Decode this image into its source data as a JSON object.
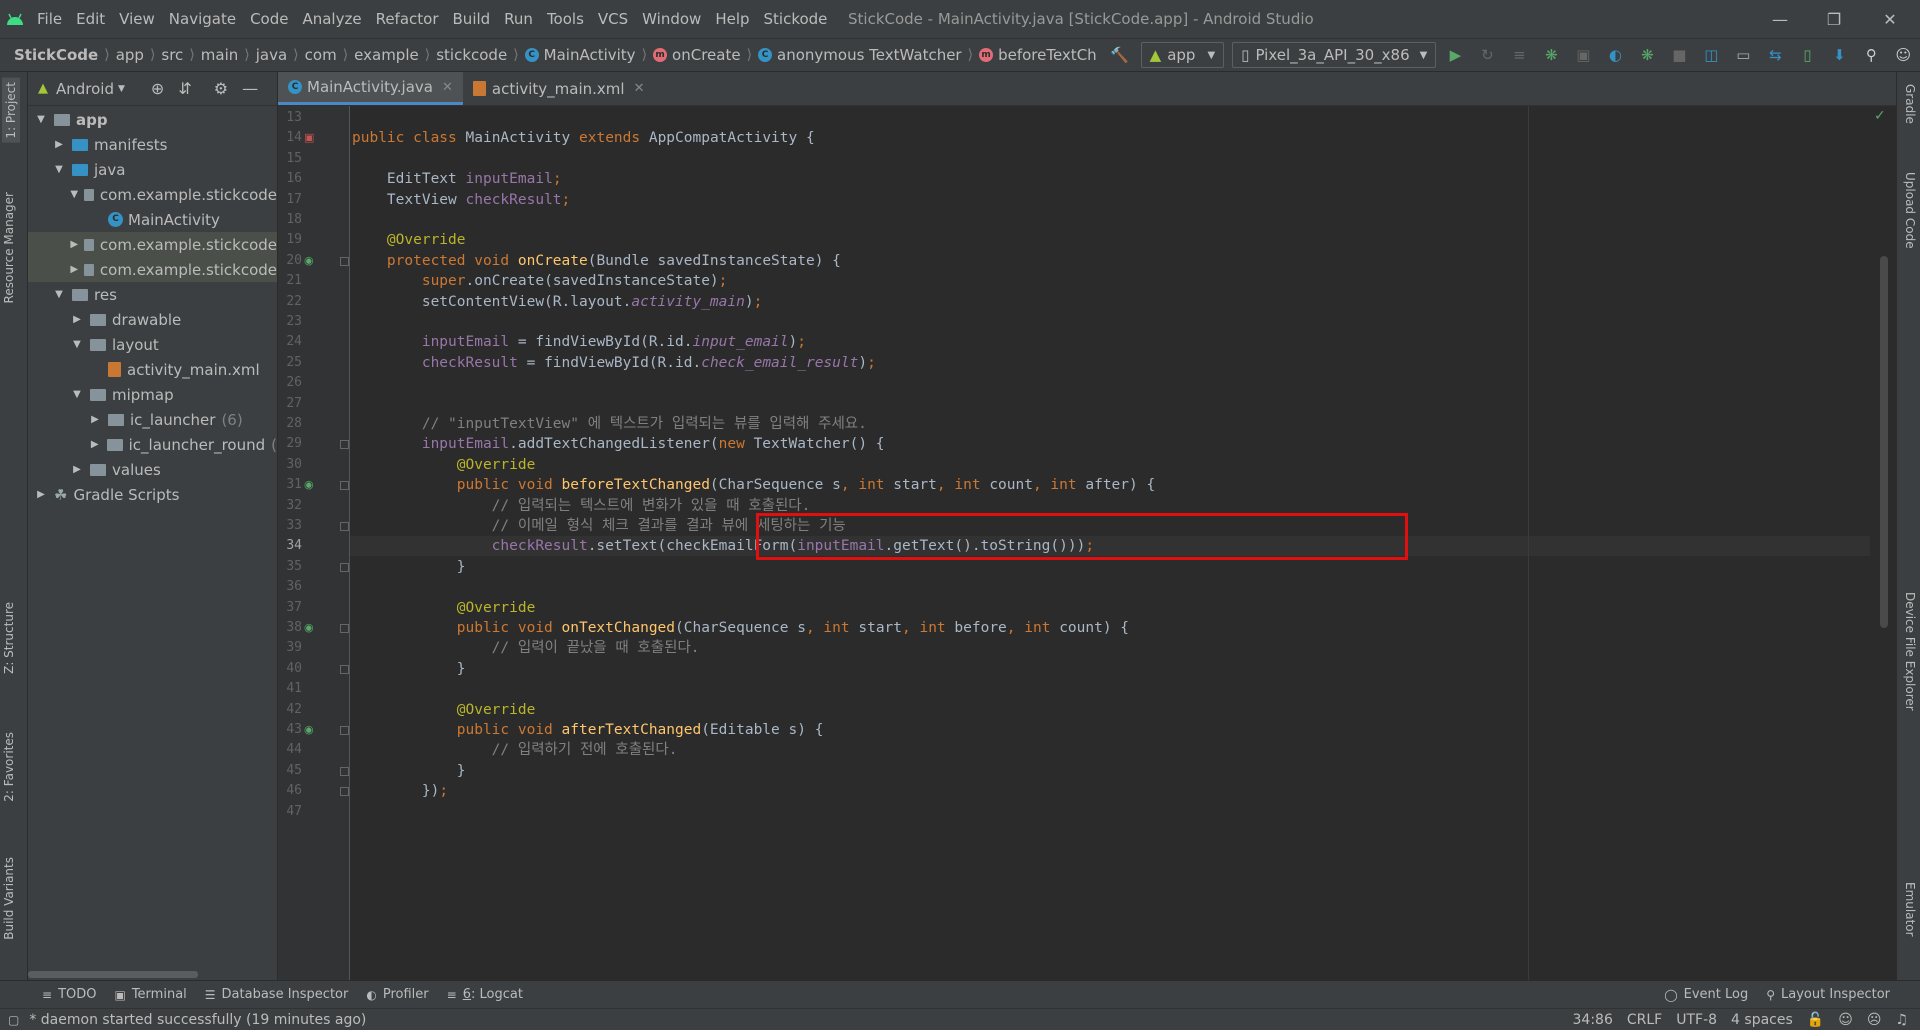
{
  "app_title": "StickCode - MainActivity.java [StickCode.app] - Android Studio",
  "menu": [
    "File",
    "Edit",
    "View",
    "Navigate",
    "Code",
    "Analyze",
    "Refactor",
    "Build",
    "Run",
    "Tools",
    "VCS",
    "Window",
    "Help",
    "Stickode"
  ],
  "breadcrumbs": [
    "StickCode",
    "app",
    "src",
    "main",
    "java",
    "com",
    "example",
    "stickcode",
    "MainActivity",
    "onCreate",
    "anonymous TextWatcher",
    "beforeTextCh"
  ],
  "run_config": "app",
  "device": "Pixel_3a_API_30_x86",
  "left_tool_tabs": [
    "1: Project",
    "Resource Manager",
    "Z: Structure",
    "2: Favorites",
    "Build Variants"
  ],
  "right_tool_tabs": [
    "Gradle",
    "Upload Code",
    "Device File Explorer",
    "Emulator"
  ],
  "project_panel": {
    "view_mode": "Android",
    "tree": [
      {
        "label": "app",
        "depth": 0,
        "arrow": "down",
        "icon": "folder",
        "bold": true
      },
      {
        "label": "manifests",
        "depth": 1,
        "arrow": "right",
        "icon": "folder-blue"
      },
      {
        "label": "java",
        "depth": 1,
        "arrow": "down",
        "icon": "folder-blue"
      },
      {
        "label": "com.example.stickcode",
        "depth": 2,
        "arrow": "down",
        "icon": "package"
      },
      {
        "label": "MainActivity",
        "depth": 3,
        "arrow": "",
        "icon": "class"
      },
      {
        "label": "com.example.stickcode",
        "depth": 2,
        "arrow": "right",
        "icon": "package",
        "selected": true
      },
      {
        "label": "com.example.stickcode",
        "depth": 2,
        "arrow": "right",
        "icon": "package",
        "selected": true
      },
      {
        "label": "res",
        "depth": 1,
        "arrow": "down",
        "icon": "folder"
      },
      {
        "label": "drawable",
        "depth": 2,
        "arrow": "right",
        "icon": "folder"
      },
      {
        "label": "layout",
        "depth": 2,
        "arrow": "down",
        "icon": "folder"
      },
      {
        "label": "activity_main.xml",
        "depth": 3,
        "arrow": "",
        "icon": "xml"
      },
      {
        "label": "mipmap",
        "depth": 2,
        "arrow": "down",
        "icon": "folder"
      },
      {
        "label": "ic_launcher",
        "depth": 3,
        "arrow": "right",
        "icon": "folder",
        "count": "(6)"
      },
      {
        "label": "ic_launcher_round",
        "depth": 3,
        "arrow": "right",
        "icon": "folder",
        "count": "("
      },
      {
        "label": "values",
        "depth": 2,
        "arrow": "right",
        "icon": "folder"
      },
      {
        "label": "Gradle Scripts",
        "depth": 0,
        "arrow": "right",
        "icon": "gradle"
      }
    ]
  },
  "editor_tabs": [
    {
      "label": "MainActivity.java",
      "active": true
    },
    {
      "label": "activity_main.xml",
      "active": false
    }
  ],
  "code_lines": [
    {
      "n": "13",
      "t": []
    },
    {
      "n": "14",
      "t": [
        [
          "kw",
          "public class "
        ],
        [
          "",
          "MainActivity "
        ],
        [
          "kw",
          "extends "
        ],
        [
          "",
          "AppCompatActivity {"
        ]
      ]
    },
    {
      "n": "15",
      "t": []
    },
    {
      "n": "16",
      "t": [
        [
          "",
          "    EditText "
        ],
        [
          "fld",
          "inputEmail"
        ],
        [
          "kw",
          ";"
        ]
      ]
    },
    {
      "n": "17",
      "t": [
        [
          "",
          "    TextView "
        ],
        [
          "fld",
          "checkResult"
        ],
        [
          "kw",
          ";"
        ]
      ]
    },
    {
      "n": "18",
      "t": []
    },
    {
      "n": "19",
      "t": [
        [
          "ann",
          "    @Override"
        ]
      ]
    },
    {
      "n": "20",
      "t": [
        [
          "kw",
          "    protected void "
        ],
        [
          "fn",
          "onCreate"
        ],
        [
          "",
          "(Bundle savedInstanceState) {"
        ]
      ]
    },
    {
      "n": "21",
      "t": [
        [
          "kw",
          "        super"
        ],
        [
          "",
          ".onCreate(savedInstanceState)"
        ],
        [
          "kw",
          ";"
        ]
      ]
    },
    {
      "n": "22",
      "t": [
        [
          "",
          "        setContentView(R.layout."
        ],
        [
          "it",
          "activity_main"
        ],
        [
          "",
          ")"
        ],
        [
          "kw",
          ";"
        ]
      ]
    },
    {
      "n": "23",
      "t": []
    },
    {
      "n": "24",
      "t": [
        [
          "fld",
          "        inputEmail "
        ],
        [
          "",
          "= findViewById(R.id."
        ],
        [
          "it",
          "input_email"
        ],
        [
          "",
          ")"
        ],
        [
          "kw",
          ";"
        ]
      ]
    },
    {
      "n": "25",
      "t": [
        [
          "fld",
          "        checkResult "
        ],
        [
          "",
          "= findViewById(R.id."
        ],
        [
          "it",
          "check_email_result"
        ],
        [
          "",
          ")"
        ],
        [
          "kw",
          ";"
        ]
      ]
    },
    {
      "n": "26",
      "t": []
    },
    {
      "n": "27",
      "t": []
    },
    {
      "n": "28",
      "t": [
        [
          "cm",
          "        // \"inputTextView\" 에 텍스트가 입력되는 뷰를 입력해 주세요."
        ]
      ]
    },
    {
      "n": "29",
      "t": [
        [
          "fld",
          "        inputEmail"
        ],
        [
          "",
          ".addTextChangedListener("
        ],
        [
          "kw",
          "new "
        ],
        [
          "",
          "TextWatcher() {"
        ]
      ]
    },
    {
      "n": "30",
      "t": [
        [
          "ann",
          "            @Override"
        ]
      ]
    },
    {
      "n": "31",
      "t": [
        [
          "kw",
          "            public void "
        ],
        [
          "fn",
          "beforeTextChanged"
        ],
        [
          "",
          "(CharSequence s"
        ],
        [
          "kw",
          ", int "
        ],
        [
          "",
          "start"
        ],
        [
          "kw",
          ", int "
        ],
        [
          "",
          "count"
        ],
        [
          "kw",
          ", int "
        ],
        [
          "",
          "after) {"
        ]
      ]
    },
    {
      "n": "32",
      "t": [
        [
          "cm",
          "                // 입력되는 텍스트에 변화가 있을 때 호출된다."
        ]
      ]
    },
    {
      "n": "33",
      "t": [
        [
          "cm",
          "                // 이메일 형식 체크 결과를 결과 뷰에 세팅하는 기능"
        ]
      ]
    },
    {
      "n": "34",
      "t": [
        [
          "fld",
          "                checkResult"
        ],
        [
          "",
          ".setText(checkEmailForm("
        ],
        [
          "fld",
          "inputEmail"
        ],
        [
          "",
          ".getText().toString()))"
        ],
        [
          "kw",
          ";"
        ]
      ]
    },
    {
      "n": "35",
      "t": [
        [
          "",
          "            }"
        ]
      ]
    },
    {
      "n": "36",
      "t": []
    },
    {
      "n": "37",
      "t": [
        [
          "ann",
          "            @Override"
        ]
      ]
    },
    {
      "n": "38",
      "t": [
        [
          "kw",
          "            public void "
        ],
        [
          "fn",
          "onTextChanged"
        ],
        [
          "",
          "(CharSequence s"
        ],
        [
          "kw",
          ", int "
        ],
        [
          "",
          "start"
        ],
        [
          "kw",
          ", int "
        ],
        [
          "",
          "before"
        ],
        [
          "kw",
          ", int "
        ],
        [
          "",
          "count) {"
        ]
      ]
    },
    {
      "n": "39",
      "t": [
        [
          "cm",
          "                // 입력이 끝났을 때 호출된다."
        ]
      ]
    },
    {
      "n": "40",
      "t": [
        [
          "",
          "            }"
        ]
      ]
    },
    {
      "n": "41",
      "t": []
    },
    {
      "n": "42",
      "t": [
        [
          "ann",
          "            @Override"
        ]
      ]
    },
    {
      "n": "43",
      "t": [
        [
          "kw",
          "            public void "
        ],
        [
          "fn",
          "afterTextChanged"
        ],
        [
          "",
          "(Editable s) {"
        ]
      ]
    },
    {
      "n": "44",
      "t": [
        [
          "cm",
          "                // 입력하기 전에 호출된다."
        ]
      ]
    },
    {
      "n": "45",
      "t": [
        [
          "",
          "            }"
        ]
      ]
    },
    {
      "n": "46",
      "t": [
        [
          "",
          "        })"
        ],
        [
          "kw",
          ";"
        ]
      ]
    },
    {
      "n": "47",
      "t": []
    }
  ],
  "current_line": "34",
  "bottom_tabs": {
    "todo": "TODO",
    "terminal": "Terminal",
    "database": "Database Inspector",
    "profiler": "Profiler",
    "logcat_num": "6",
    "logcat": ": Logcat",
    "event_log": "Event Log",
    "layout_inspector": "Layout Inspector"
  },
  "status": {
    "message": "* daemon started successfully (19 minutes ago)",
    "position": "34:86",
    "line_sep": "CRLF",
    "encoding": "UTF-8",
    "indent": "4 spaces"
  },
  "colors": {
    "accent": "#4a88c7",
    "highlight_box": "#e01010",
    "android_green": "#a4c639"
  }
}
